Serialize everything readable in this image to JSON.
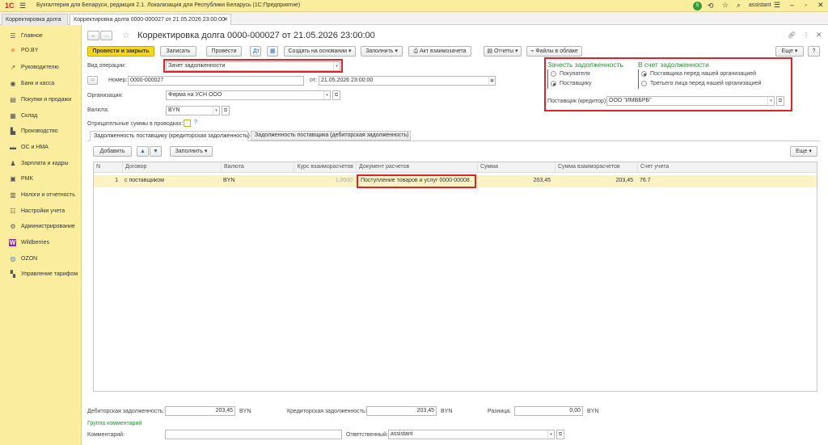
{
  "app": {
    "logo_text": "1С",
    "title": "Бухгалтерия для Беларуси, редакция 2.1. Локализация для Республики Беларусь   (1С:Предприятие)",
    "notification_count": "5",
    "user": "assistant"
  },
  "tabs": [
    {
      "label": "Корректировка долга"
    },
    {
      "label": "Корректировка долга 0000-000027 от 21.05.2026 23:00:00"
    }
  ],
  "sidebar": {
    "items": [
      {
        "icon": "menu-icon",
        "glyph": "☰",
        "label": "Главное"
      },
      {
        "icon": "po-icon",
        "glyph": "✳",
        "label": "PO.BY"
      },
      {
        "icon": "chart-icon",
        "glyph": "↗",
        "label": "Руководителю"
      },
      {
        "icon": "bank-icon",
        "glyph": "◉",
        "label": "Банк и касса"
      },
      {
        "icon": "cart-icon",
        "glyph": "▤",
        "label": "Покупки и продажи"
      },
      {
        "icon": "warehouse-icon",
        "glyph": "▦",
        "label": "Склад"
      },
      {
        "icon": "factory-icon",
        "glyph": "▙",
        "label": "Производство"
      },
      {
        "icon": "assets-icon",
        "glyph": "▬",
        "label": "ОС и НМА"
      },
      {
        "icon": "salary-icon",
        "glyph": "♟",
        "label": "Зарплата и кадры"
      },
      {
        "icon": "pmk-icon",
        "glyph": "▣",
        "label": "PMK"
      },
      {
        "icon": "taxes-icon",
        "glyph": "▥",
        "label": "Налоги и отчетность"
      },
      {
        "icon": "settings-icon",
        "glyph": "☷",
        "label": "Настройки учета"
      },
      {
        "icon": "gear-icon",
        "glyph": "⚙",
        "label": "Администрирование"
      },
      {
        "icon": "wildberries-icon",
        "glyph": "W",
        "label": "Wildberries"
      },
      {
        "icon": "ozon-icon",
        "glyph": "◎",
        "label": "OZON"
      },
      {
        "icon": "tariff-icon",
        "glyph": "▚",
        "label": "Управление тарифом"
      }
    ]
  },
  "doc": {
    "title": "Корректировка долга 0000-000027 от 21.05.2026 23:00:00"
  },
  "toolbar": {
    "post_close": "Провести и закрыть",
    "save": "Записать",
    "post": "Провести",
    "create_based": "Создать на основании",
    "fill": "Заполнить",
    "act": "Акт взаимозачета",
    "reports": "Отчеты",
    "cloud": "Файлы в облаке",
    "more": "Еще"
  },
  "form": {
    "op_label": "Вид операции:",
    "op_value": "Зачет задолженности",
    "num_label": "Номер:",
    "num_value": "0000-000027",
    "date_label": "от:",
    "date_value": "21.05.2026 23:00:00",
    "org_label": "Организация:",
    "org_value": "Фирма на УСН ООО",
    "cur_label": "Валюта:",
    "cur_value": "BYN",
    "neg_label": "Отрицательные суммы в проводках:",
    "help": "?"
  },
  "offset": {
    "title": "Зачесть задолженность",
    "opt1": "Покупателя",
    "opt2": "Поставщику",
    "title2": "В счет задолженности",
    "opt3": "Поставщика перед нашей организацией",
    "opt4": "Третьего лица перед нашей организацией",
    "supplier_label": "Поставщик (кредитор):",
    "supplier_value": "ООО \"ИМВБРБ\""
  },
  "subtabs": [
    {
      "label": "Задолженность поставщику (кредиторская задолженность)"
    },
    {
      "label": "Задолженность поставщика (дебиторская задолженность)"
    }
  ],
  "table_toolbar": {
    "add": "Добавить",
    "fill": "Заполнить",
    "more": "Еще"
  },
  "table": {
    "headers": [
      "N",
      "Договор",
      "Валюта",
      "Курс взаиморасчетов",
      "Документ расчетов",
      "Сумма",
      "Сумма взаиморасчетов",
      "Счет учета"
    ],
    "rows": [
      [
        "1",
        "с поставщиком",
        "BYN",
        "1,0000",
        "Поступление товаров и услуг 0000-00008 ...",
        "203,45",
        "203,45",
        "76.7"
      ]
    ]
  },
  "footer": {
    "debit_label": "Дебиторская задолженность:",
    "debit_value": "203,45",
    "debit_cur": "BYN",
    "credit_label": "Кредиторская задолженность:",
    "credit_value": "203,45",
    "credit_cur": "BYN",
    "diff_label": "Разница:",
    "diff_value": "0,00",
    "diff_cur": "BYN",
    "comments_group": "Группа комментарий",
    "comment_label": "Комментарий:",
    "resp_label": "Ответственный:",
    "resp_value": "assistant"
  }
}
